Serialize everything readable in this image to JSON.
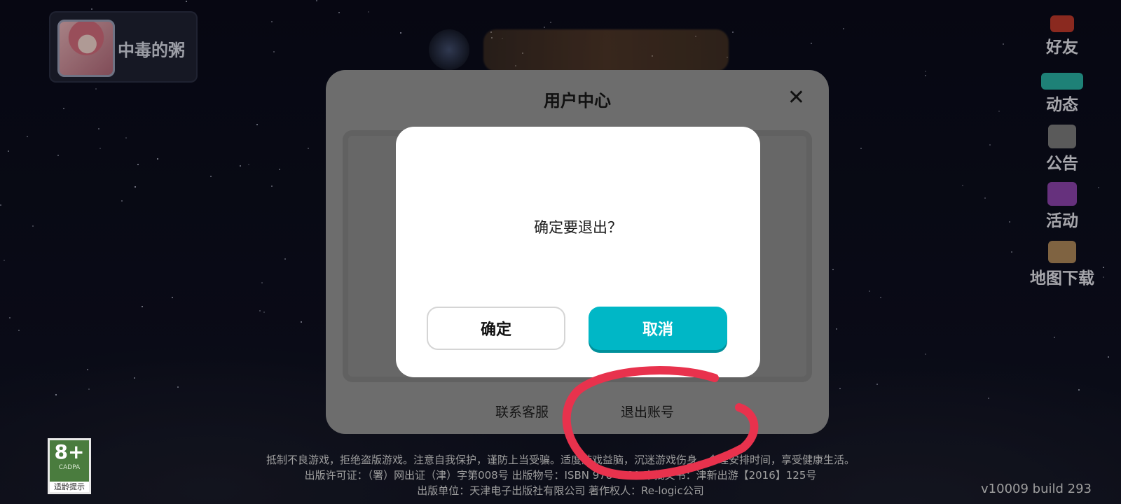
{
  "profile": {
    "name": "中毒的粥"
  },
  "side_menu": [
    {
      "label": "好友",
      "icon": "friends-icon",
      "accent": "#c0392b"
    },
    {
      "label": "动态",
      "icon": "taptap-moments-icon",
      "accent": "#2ab3a6"
    },
    {
      "label": "公告",
      "icon": "announcement-icon",
      "accent": "#7d7d7d"
    },
    {
      "label": "活动",
      "icon": "event-gift-icon",
      "accent": "#8e44ad"
    },
    {
      "label": "地图下载",
      "icon": "map-download-icon",
      "accent": "#b08a5a"
    }
  ],
  "user_center": {
    "title": "用户中心",
    "close_glyph": "✕",
    "contact_label": "联系客服",
    "logout_label": "退出账号"
  },
  "confirm_dialog": {
    "message": "确定要退出？",
    "ok_label": "确定",
    "cancel_label": "取消",
    "cancel_color": "#00b7c6"
  },
  "rating": {
    "age": "8+",
    "org": "CADPA",
    "tip": "适龄提示"
  },
  "notice": {
    "line1": "抵制不良游戏，拒绝盗版游戏。注意自我保护，谨防上当受骗。适度游戏益脑，沉迷游戏伤身。合理安排时间，享受健康生活。",
    "line2": "出版许可证：（署）网出证（津）字第008号 出版物号：ISBN 978-7-89 审批文书：津新出游【2016】125号",
    "line3": "出版单位：天津电子出版社有限公司 著作权人：Re-logic公司"
  },
  "version": "v10009   build 293",
  "annotation_color": "#e8324d"
}
